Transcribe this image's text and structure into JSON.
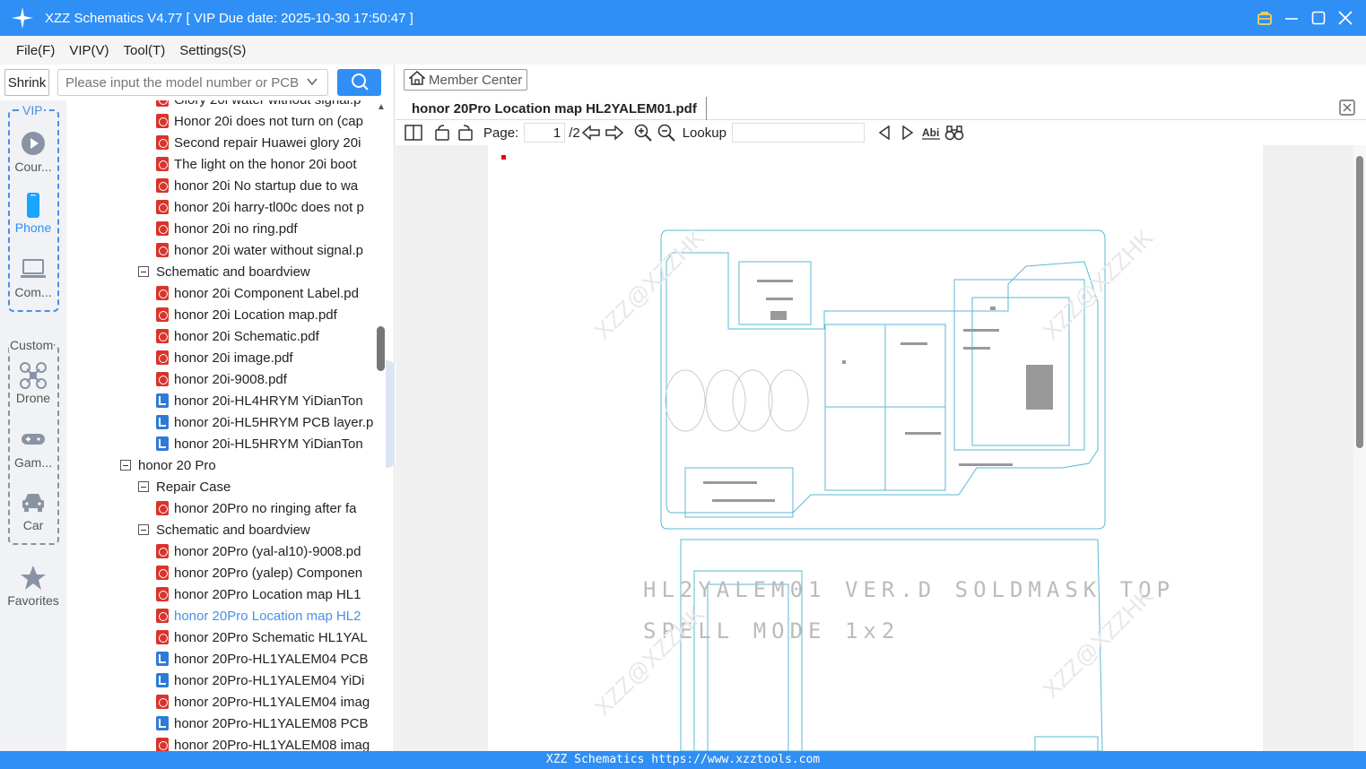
{
  "title_bar": {
    "title": "XZZ Schematics V4.77 [ VIP Due date: 2025-10-30 17:50:47 ]"
  },
  "menu": {
    "file": "File(F)",
    "vip": "VIP(V)",
    "tool": "Tool(T)",
    "settings": "Settings(S)"
  },
  "left": {
    "shrink_label": "Shrink",
    "search_placeholder": "Please input the model number or PCB",
    "vip_label": "VIP",
    "custom_label": "Custom",
    "categories": {
      "courses": "Cour...",
      "phone": "Phone",
      "computer": "Com...",
      "drone": "Drone",
      "game": "Gam...",
      "car": "Car",
      "favorites": "Favorites"
    },
    "tree": [
      {
        "text": "Glory 20i water without signal.p",
        "type": "pdf",
        "indent": 2
      },
      {
        "text": "Honor 20i does not turn on (cap",
        "type": "pdf",
        "indent": 2
      },
      {
        "text": "Second repair Huawei glory 20i",
        "type": "pdf",
        "indent": 2
      },
      {
        "text": "The light on the honor 20i boot",
        "type": "pdf",
        "indent": 2
      },
      {
        "text": "honor 20i No startup due to wa",
        "type": "pdf",
        "indent": 2
      },
      {
        "text": "honor 20i harry-tl00c does not p",
        "type": "pdf",
        "indent": 2
      },
      {
        "text": "honor 20i no ring.pdf",
        "type": "pdf",
        "indent": 2
      },
      {
        "text": "honor 20i water without signal.p",
        "type": "pdf",
        "indent": 2
      },
      {
        "text": "Schematic and boardview",
        "type": "folder",
        "indent": 1
      },
      {
        "text": "honor 20i Component Label.pd",
        "type": "pdf",
        "indent": 2
      },
      {
        "text": "honor 20i Location map.pdf",
        "type": "pdf",
        "indent": 2
      },
      {
        "text": "honor 20i Schematic.pdf",
        "type": "pdf",
        "indent": 2
      },
      {
        "text": "honor 20i image.pdf",
        "type": "pdf",
        "indent": 2
      },
      {
        "text": "honor 20i-9008.pdf",
        "type": "pdf",
        "indent": 2
      },
      {
        "text": "honor 20i-HL4HRYM YiDianTon",
        "type": "bv",
        "indent": 2
      },
      {
        "text": "honor 20i-HL5HRYM PCB layer.p",
        "type": "bv",
        "indent": 2
      },
      {
        "text": "honor 20i-HL5HRYM YiDianTon",
        "type": "bv",
        "indent": 2
      },
      {
        "text": "honor 20 Pro",
        "type": "folder",
        "indent": 0
      },
      {
        "text": "Repair Case",
        "type": "folder",
        "indent": 1
      },
      {
        "text": "honor 20Pro no ringing after fa",
        "type": "pdf",
        "indent": 2
      },
      {
        "text": "Schematic and boardview",
        "type": "folder",
        "indent": 1
      },
      {
        "text": "honor 20Pro (yal-al10)-9008.pd",
        "type": "pdf",
        "indent": 2
      },
      {
        "text": "honor 20Pro (yalep) Componen",
        "type": "pdf",
        "indent": 2
      },
      {
        "text": "honor 20Pro Location map HL1",
        "type": "pdf",
        "indent": 2
      },
      {
        "text": "honor 20Pro Location map HL2",
        "type": "pdf",
        "indent": 2,
        "selected": true
      },
      {
        "text": "honor 20Pro Schematic HL1YAL",
        "type": "pdf",
        "indent": 2
      },
      {
        "text": "honor 20Pro-HL1YALEM04 PCB",
        "type": "bv",
        "indent": 2
      },
      {
        "text": "honor 20Pro-HL1YALEM04 YiDi",
        "type": "bv",
        "indent": 2
      },
      {
        "text": "honor 20Pro-HL1YALEM04 imag",
        "type": "pdf",
        "indent": 2
      },
      {
        "text": "honor 20Pro-HL1YALEM08 PCB",
        "type": "bv",
        "indent": 2
      },
      {
        "text": "honor 20Pro-HL1YALEM08 imag",
        "type": "pdf",
        "indent": 2
      }
    ]
  },
  "right": {
    "member_center": "Member Center",
    "tab_title": "honor 20Pro Location map HL2YALEM01.pdf",
    "page_label": "Page:",
    "page_current": "1",
    "page_total": "/2",
    "lookup_label": "Lookup",
    "doc_text_line1": "HL2YALEM01 VER.D SOLDMASK TOP",
    "doc_text_line2": "SPELL MODE 1x2",
    "watermark": "XZZ@XZZHK"
  },
  "status": {
    "text": "XZZ Schematics https://www.xzztools.com"
  },
  "colors": {
    "accent": "#2f8ff5",
    "pcb_line": "#5bb8d6",
    "selected": "#4a90e2"
  }
}
